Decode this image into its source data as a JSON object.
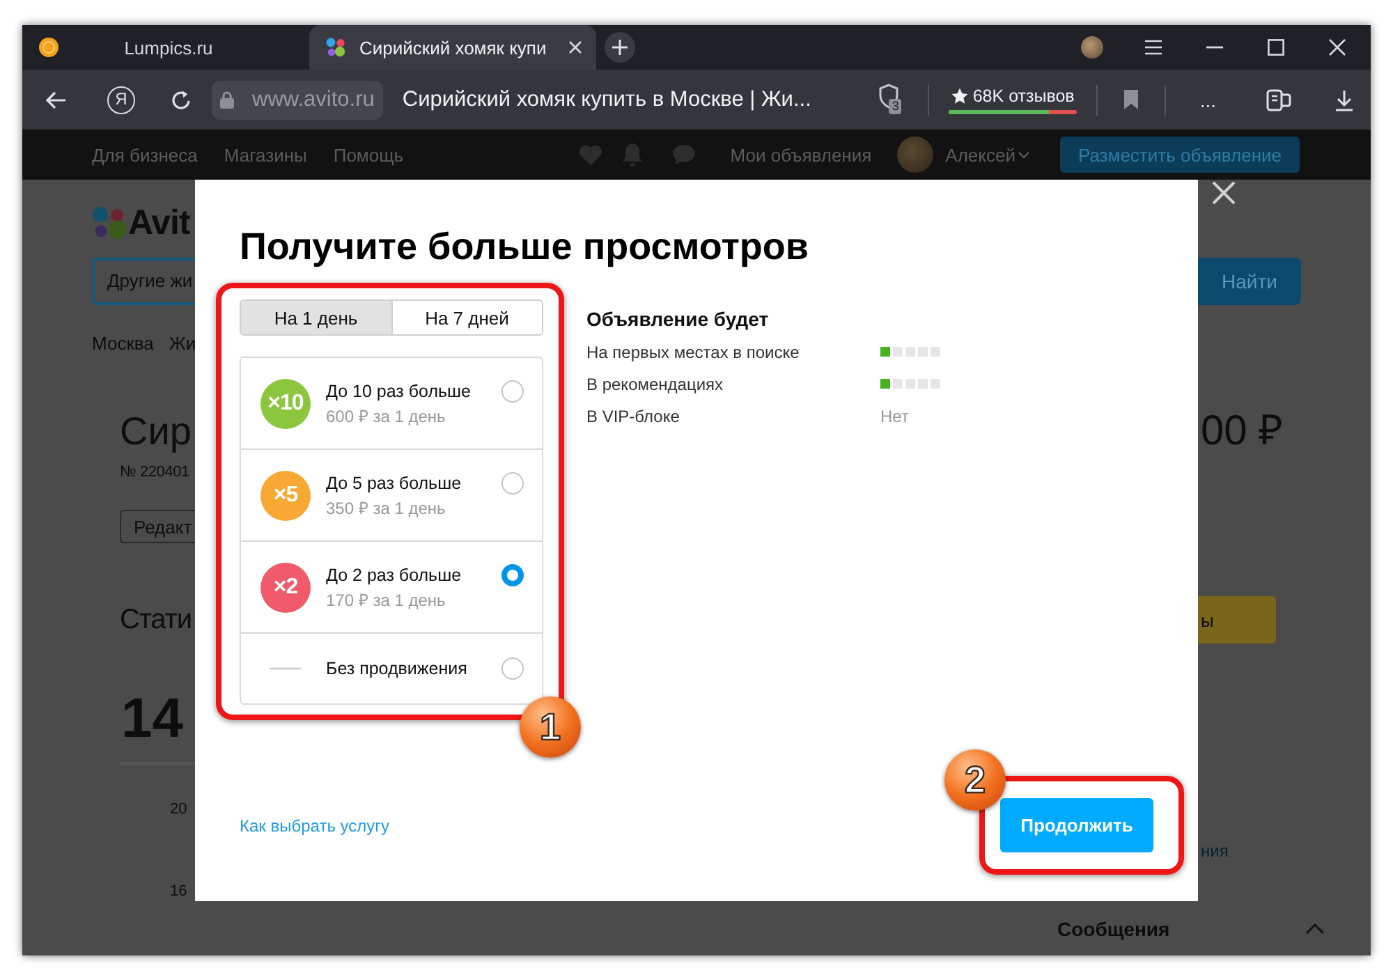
{
  "browser": {
    "tabs": [
      {
        "kind": "circle",
        "title": "Lumpics.ru",
        "selected": false
      },
      {
        "kind": "dots",
        "title": "Сирийский хомяк купи",
        "selected": true
      }
    ],
    "address_bar": {
      "home_button": "Я",
      "domain": "www.avito.ru",
      "page_title": "Сирийский хомяк купить в Москве | Жи...",
      "shield_count": "3",
      "reviews": {
        "label": "68K отзывов",
        "level": 0.78
      },
      "more_button": "..."
    }
  },
  "site_header": {
    "links": [
      "Для бизнеса",
      "Магазины",
      "Помощь"
    ],
    "my_ads": "Мои объявления",
    "user_name": "Алексей",
    "post_ad_button": "Разместить объявление"
  },
  "page": {
    "logo": "Avit",
    "search_field": {
      "value": "Другие жи"
    },
    "search_button": "Найти",
    "breadcrumbs": [
      "Москва",
      "Жи"
    ],
    "title": "Сир",
    "ad_number": "№ 220401",
    "edit_button": "Редакт",
    "price": "00 ₽",
    "stats_heading": "Стати",
    "views": "14",
    "promo_button": "ы",
    "axis_labels": [
      "20",
      "16"
    ],
    "stats_link": "ния",
    "messages": "Сообщения"
  },
  "modal": {
    "title": "Получите больше просмотров",
    "periods": [
      {
        "label": "На 1 день",
        "selected": true
      },
      {
        "label": "На 7 дней",
        "selected": false
      }
    ],
    "options": [
      {
        "kind": "boost",
        "badge": "×10",
        "color": "#8cc63f",
        "title": "До 10 раз больше",
        "price": "600 ₽ за 1 день",
        "selected": false
      },
      {
        "kind": "boost",
        "badge": "×5",
        "color": "#f7a934",
        "title": "До 5 раз больше",
        "price": "350 ₽ за 1 день",
        "selected": false
      },
      {
        "kind": "boost",
        "badge": "×2",
        "color": "#f05a6a",
        "title": "До 2 раз больше",
        "price": "170 ₽ за 1 день",
        "selected": true
      },
      {
        "kind": "none",
        "title": "Без продвижения",
        "selected": false
      }
    ],
    "features_heading": "Объявление будет",
    "features": [
      {
        "kind": "meter",
        "label": "На первых местах в поиске",
        "level": 0.2
      },
      {
        "kind": "meter",
        "label": "В рекомендациях",
        "level": 0.2
      },
      {
        "kind": "text",
        "label": "В VIP-блоке",
        "value": "Нет"
      }
    ],
    "help_link": "Как выбрать услугу",
    "continue_button": "Продолжить"
  },
  "annotations": [
    {
      "number": "1"
    },
    {
      "number": "2"
    }
  ]
}
